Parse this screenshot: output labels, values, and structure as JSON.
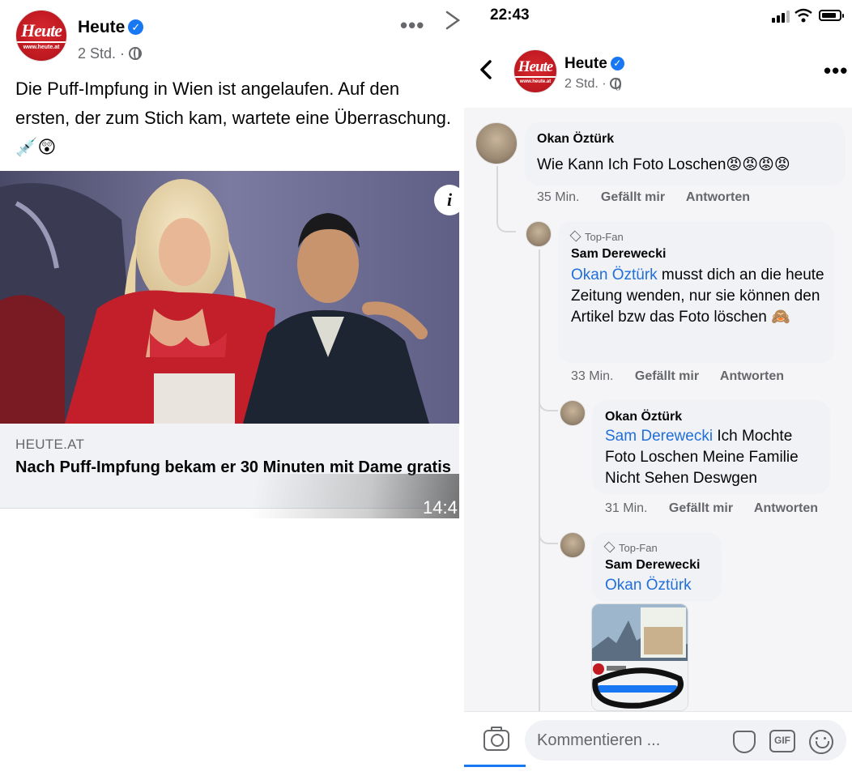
{
  "left_post": {
    "page_name": "Heute",
    "time": "2 Std.",
    "separator": "·",
    "logo_text": "Heute",
    "logo_url_text": "www.heute.at",
    "more_label": "•••",
    "close_label": "✕",
    "text": "Die Puff-Impfung in Wien ist angelaufen. Auf den ersten, der zum Stich kam, wartete eine Überraschung. 💉😲",
    "info_label": "i",
    "link": {
      "domain": "HEUTE.AT",
      "title": "Nach Puff-Impfung bekam er 30 Minuten mit Dame gratis"
    },
    "clock": "14:4"
  },
  "right_panel": {
    "status": {
      "time": "22:43"
    },
    "header": {
      "back_label": "‹",
      "page_name": "Heute",
      "time": "2 Std.",
      "separator": "·",
      "more_label": "•••"
    },
    "comments": [
      {
        "author": "Okan Öztürk",
        "text": "Wie Kann Ich Foto Loschen😡😡😡😡",
        "time": "35 Min.",
        "like": "Gefällt mir",
        "reply": "Antworten"
      },
      {
        "badge": "Top-Fan",
        "author": "Sam Derewecki",
        "mention": "Okan Öztürk",
        "text": " musst dich an die heute Zeitung wenden, nur sie können den Artikel bzw das Foto löschen 🙈",
        "time": "33 Min.",
        "like": "Gefällt mir",
        "reply": "Antworten"
      },
      {
        "author": "Okan Öztürk",
        "mention": "Sam Derewecki",
        "text": "  Ich Mochte Foto Loschen Meine Familie Nicht Sehen Deswgen",
        "time": "31 Min.",
        "like": "Gefällt mir",
        "reply": "Antworten"
      },
      {
        "badge": "Top-Fan",
        "author": "Sam Derewecki",
        "mention": "Okan Öztürk"
      }
    ],
    "composer": {
      "placeholder": "Kommentieren ...",
      "gif_label": "GIF"
    }
  },
  "colors": {
    "brand_red": "#c21a22",
    "link_blue": "#216fdb",
    "verified_blue": "#1877f2",
    "secondary_text": "#65676b"
  },
  "icons": [
    "verified-icon",
    "globe-icon",
    "more-icon",
    "close-icon",
    "info-icon",
    "back-icon",
    "camera-icon",
    "sticker-icon",
    "gif-icon",
    "emoji-icon",
    "top-fan-diamond-icon"
  ]
}
